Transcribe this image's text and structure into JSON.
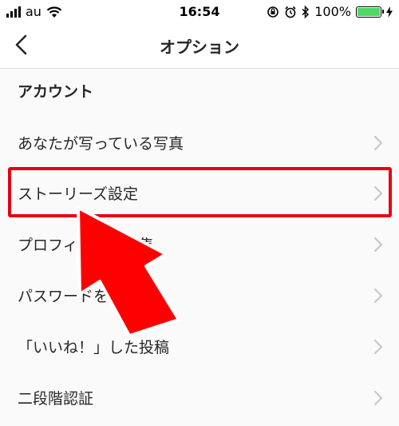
{
  "status_bar": {
    "carrier": "au",
    "time": "16:54",
    "battery_percent": "100%",
    "battery_level": 1.0
  },
  "nav": {
    "title": "オプション"
  },
  "section": {
    "title": "アカウント"
  },
  "menu_items": [
    {
      "label": "あなたが写っている写真"
    },
    {
      "label": "ストーリーズ設定"
    },
    {
      "label": "プロフィールを編集"
    },
    {
      "label": "パスワードを変更"
    },
    {
      "label": "「いいね！」した投稿"
    },
    {
      "label": "二段階認証"
    }
  ],
  "colors": {
    "highlight": "#e60012",
    "battery": "#4cd964"
  }
}
